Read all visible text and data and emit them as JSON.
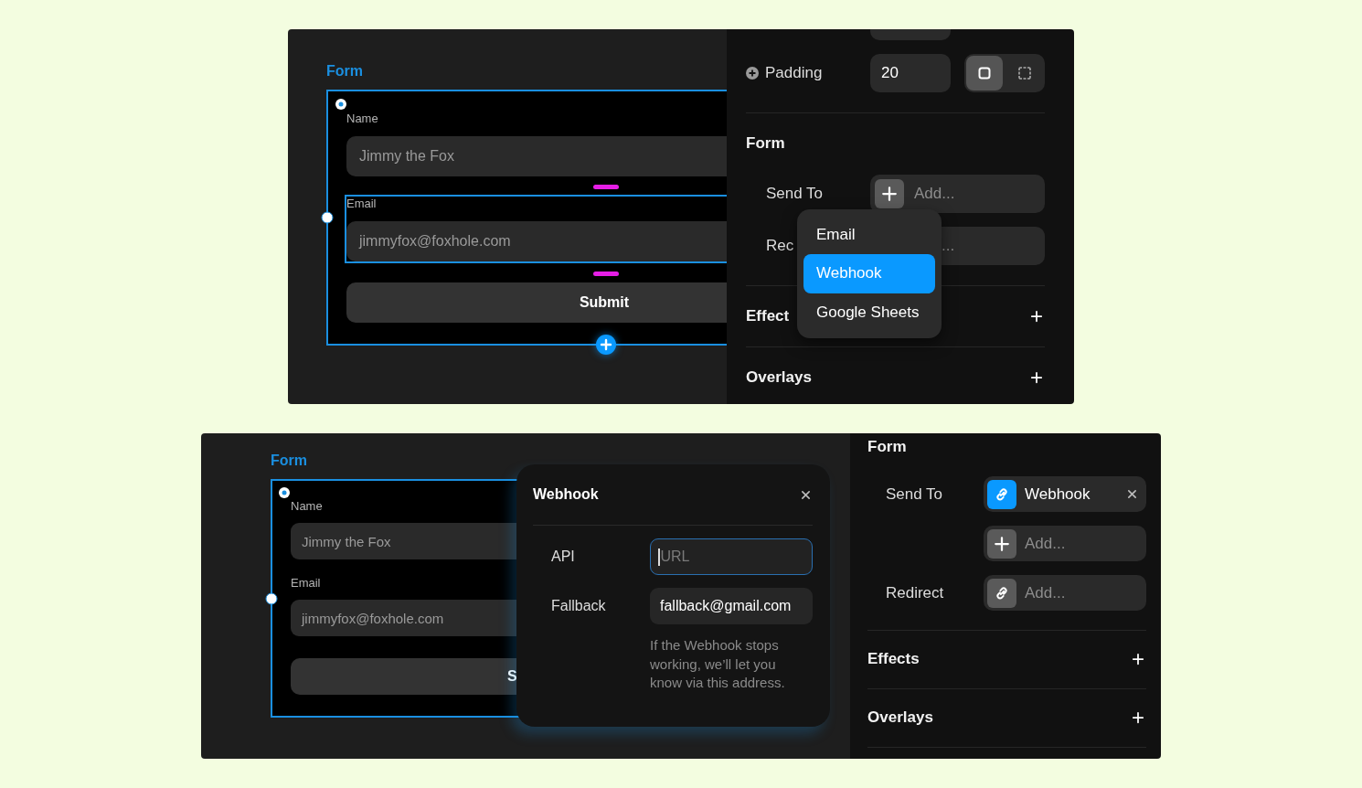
{
  "top": {
    "canvas": {
      "title": "Form",
      "fields": [
        {
          "label": "Name",
          "value": "Jimmy the Fox",
          "selected": false
        },
        {
          "label": "Email",
          "value": "jimmyfox@foxhole.com",
          "selected": true
        }
      ],
      "button": "Submit"
    },
    "properties": {
      "padding": {
        "label": "Padding",
        "value": "20",
        "modes": [
          {
            "kind": "uniform",
            "selected": true
          },
          {
            "kind": "individual",
            "selected": false
          }
        ]
      },
      "form_title": "Form",
      "rows": [
        {
          "label": "Send To",
          "text": "Add..."
        },
        {
          "label": "Rec",
          "text": "..."
        }
      ],
      "sections": [
        {
          "title": "Effect"
        },
        {
          "title": "Overlays"
        }
      ]
    },
    "dropdown": {
      "items": [
        {
          "label": "Email",
          "selected": false
        },
        {
          "label": "Webhook",
          "selected": true
        },
        {
          "label": "Google Sheets",
          "selected": false
        }
      ]
    }
  },
  "bottom": {
    "canvas": {
      "title": "Form",
      "fields": [
        {
          "label": "Name",
          "value": "Jimmy the Fox",
          "selected": false
        },
        {
          "label": "Email",
          "value": "jimmyfox@foxhole.com",
          "selected": false
        }
      ],
      "button": "S"
    },
    "popup": {
      "title": "Webhook",
      "rows": [
        {
          "label": "API",
          "placeholder": "URL",
          "focused": true
        },
        {
          "label": "Fallback",
          "value": "fallback@gmail.com",
          "focused": false
        }
      ],
      "note": "If the Webhook stops working, we’ll let you know via this address."
    },
    "properties": {
      "form_title": "Form",
      "rows": [
        {
          "label": "Send To",
          "kind": "chip",
          "text": "Webhook"
        },
        {
          "kind": "add",
          "text": "Add..."
        },
        {
          "label": "Redirect",
          "kind": "link",
          "text": "Add..."
        }
      ],
      "sections": [
        {
          "title": "Effects"
        },
        {
          "title": "Overlays"
        }
      ]
    }
  }
}
